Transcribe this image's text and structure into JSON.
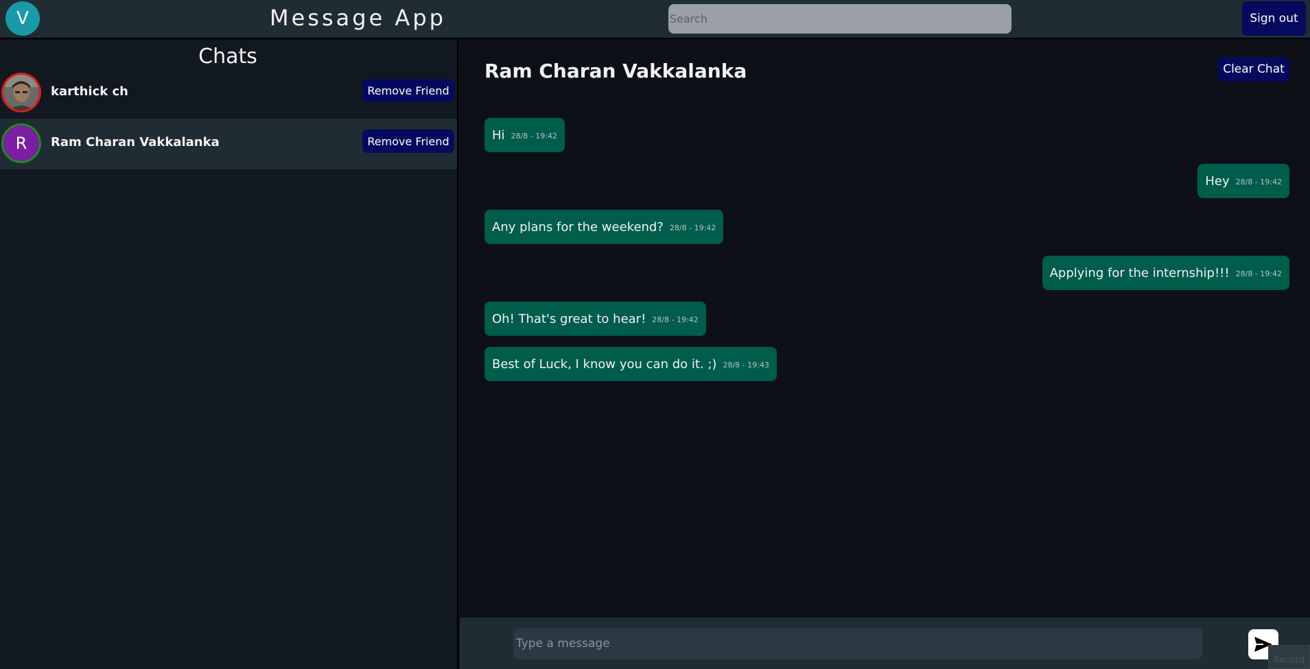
{
  "header": {
    "avatar_letter": "V",
    "app_title": "Message App",
    "search_placeholder": "Search",
    "signout_label": "Sign out"
  },
  "sidebar": {
    "title": "Chats",
    "contacts": [
      {
        "name": "karthick ch",
        "button": "Remove Friend",
        "avatar": "photo",
        "ring_color": "#e01b1b"
      },
      {
        "name": "Ram Charan Vakkalanka",
        "button": "Remove Friend",
        "avatar": "R",
        "ring_color": "#1f8a1f"
      }
    ]
  },
  "chat": {
    "title": "Ram Charan Vakkalanka",
    "clear_label": "Clear Chat",
    "messages": [
      {
        "side": "left",
        "text": "Hi",
        "time": "28/8 - 19:42"
      },
      {
        "side": "right",
        "text": "Hey",
        "time": "28/8 - 19:42"
      },
      {
        "side": "left",
        "text": "Any plans for the weekend?",
        "time": "28/8 - 19:42"
      },
      {
        "side": "right",
        "text": "Applying for the internship!!!",
        "time": "28/8 - 19:42"
      },
      {
        "side": "left",
        "text": "Oh! That's great to hear!",
        "time": "28/8 - 19:42"
      },
      {
        "side": "left",
        "text": "Best of Luck, I know you can do it. ;)",
        "time": "28/8 - 19:43"
      }
    ],
    "input_placeholder": "Type a message",
    "send_icon": "send-icon",
    "record_label": "Record"
  },
  "colors": {
    "bubble": "#005c4b",
    "button": "#060a5e",
    "panel": "#202c33"
  }
}
